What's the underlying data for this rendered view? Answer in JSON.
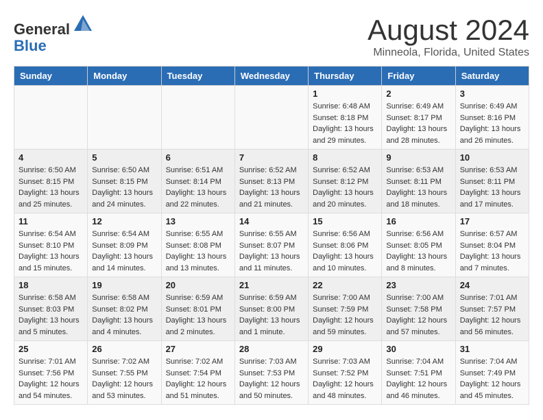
{
  "header": {
    "logo_line1": "General",
    "logo_line2": "Blue",
    "month": "August 2024",
    "location": "Minneola, Florida, United States"
  },
  "weekdays": [
    "Sunday",
    "Monday",
    "Tuesday",
    "Wednesday",
    "Thursday",
    "Friday",
    "Saturday"
  ],
  "weeks": [
    [
      {
        "day": "",
        "sunrise": "",
        "sunset": "",
        "daylight": ""
      },
      {
        "day": "",
        "sunrise": "",
        "sunset": "",
        "daylight": ""
      },
      {
        "day": "",
        "sunrise": "",
        "sunset": "",
        "daylight": ""
      },
      {
        "day": "",
        "sunrise": "",
        "sunset": "",
        "daylight": ""
      },
      {
        "day": "1",
        "sunrise": "Sunrise: 6:48 AM",
        "sunset": "Sunset: 8:18 PM",
        "daylight": "Daylight: 13 hours and 29 minutes."
      },
      {
        "day": "2",
        "sunrise": "Sunrise: 6:49 AM",
        "sunset": "Sunset: 8:17 PM",
        "daylight": "Daylight: 13 hours and 28 minutes."
      },
      {
        "day": "3",
        "sunrise": "Sunrise: 6:49 AM",
        "sunset": "Sunset: 8:16 PM",
        "daylight": "Daylight: 13 hours and 26 minutes."
      }
    ],
    [
      {
        "day": "4",
        "sunrise": "Sunrise: 6:50 AM",
        "sunset": "Sunset: 8:15 PM",
        "daylight": "Daylight: 13 hours and 25 minutes."
      },
      {
        "day": "5",
        "sunrise": "Sunrise: 6:50 AM",
        "sunset": "Sunset: 8:15 PM",
        "daylight": "Daylight: 13 hours and 24 minutes."
      },
      {
        "day": "6",
        "sunrise": "Sunrise: 6:51 AM",
        "sunset": "Sunset: 8:14 PM",
        "daylight": "Daylight: 13 hours and 22 minutes."
      },
      {
        "day": "7",
        "sunrise": "Sunrise: 6:52 AM",
        "sunset": "Sunset: 8:13 PM",
        "daylight": "Daylight: 13 hours and 21 minutes."
      },
      {
        "day": "8",
        "sunrise": "Sunrise: 6:52 AM",
        "sunset": "Sunset: 8:12 PM",
        "daylight": "Daylight: 13 hours and 20 minutes."
      },
      {
        "day": "9",
        "sunrise": "Sunrise: 6:53 AM",
        "sunset": "Sunset: 8:11 PM",
        "daylight": "Daylight: 13 hours and 18 minutes."
      },
      {
        "day": "10",
        "sunrise": "Sunrise: 6:53 AM",
        "sunset": "Sunset: 8:11 PM",
        "daylight": "Daylight: 13 hours and 17 minutes."
      }
    ],
    [
      {
        "day": "11",
        "sunrise": "Sunrise: 6:54 AM",
        "sunset": "Sunset: 8:10 PM",
        "daylight": "Daylight: 13 hours and 15 minutes."
      },
      {
        "day": "12",
        "sunrise": "Sunrise: 6:54 AM",
        "sunset": "Sunset: 8:09 PM",
        "daylight": "Daylight: 13 hours and 14 minutes."
      },
      {
        "day": "13",
        "sunrise": "Sunrise: 6:55 AM",
        "sunset": "Sunset: 8:08 PM",
        "daylight": "Daylight: 13 hours and 13 minutes."
      },
      {
        "day": "14",
        "sunrise": "Sunrise: 6:55 AM",
        "sunset": "Sunset: 8:07 PM",
        "daylight": "Daylight: 13 hours and 11 minutes."
      },
      {
        "day": "15",
        "sunrise": "Sunrise: 6:56 AM",
        "sunset": "Sunset: 8:06 PM",
        "daylight": "Daylight: 13 hours and 10 minutes."
      },
      {
        "day": "16",
        "sunrise": "Sunrise: 6:56 AM",
        "sunset": "Sunset: 8:05 PM",
        "daylight": "Daylight: 13 hours and 8 minutes."
      },
      {
        "day": "17",
        "sunrise": "Sunrise: 6:57 AM",
        "sunset": "Sunset: 8:04 PM",
        "daylight": "Daylight: 13 hours and 7 minutes."
      }
    ],
    [
      {
        "day": "18",
        "sunrise": "Sunrise: 6:58 AM",
        "sunset": "Sunset: 8:03 PM",
        "daylight": "Daylight: 13 hours and 5 minutes."
      },
      {
        "day": "19",
        "sunrise": "Sunrise: 6:58 AM",
        "sunset": "Sunset: 8:02 PM",
        "daylight": "Daylight: 13 hours and 4 minutes."
      },
      {
        "day": "20",
        "sunrise": "Sunrise: 6:59 AM",
        "sunset": "Sunset: 8:01 PM",
        "daylight": "Daylight: 13 hours and 2 minutes."
      },
      {
        "day": "21",
        "sunrise": "Sunrise: 6:59 AM",
        "sunset": "Sunset: 8:00 PM",
        "daylight": "Daylight: 13 hours and 1 minute."
      },
      {
        "day": "22",
        "sunrise": "Sunrise: 7:00 AM",
        "sunset": "Sunset: 7:59 PM",
        "daylight": "Daylight: 12 hours and 59 minutes."
      },
      {
        "day": "23",
        "sunrise": "Sunrise: 7:00 AM",
        "sunset": "Sunset: 7:58 PM",
        "daylight": "Daylight: 12 hours and 57 minutes."
      },
      {
        "day": "24",
        "sunrise": "Sunrise: 7:01 AM",
        "sunset": "Sunset: 7:57 PM",
        "daylight": "Daylight: 12 hours and 56 minutes."
      }
    ],
    [
      {
        "day": "25",
        "sunrise": "Sunrise: 7:01 AM",
        "sunset": "Sunset: 7:56 PM",
        "daylight": "Daylight: 12 hours and 54 minutes."
      },
      {
        "day": "26",
        "sunrise": "Sunrise: 7:02 AM",
        "sunset": "Sunset: 7:55 PM",
        "daylight": "Daylight: 12 hours and 53 minutes."
      },
      {
        "day": "27",
        "sunrise": "Sunrise: 7:02 AM",
        "sunset": "Sunset: 7:54 PM",
        "daylight": "Daylight: 12 hours and 51 minutes."
      },
      {
        "day": "28",
        "sunrise": "Sunrise: 7:03 AM",
        "sunset": "Sunset: 7:53 PM",
        "daylight": "Daylight: 12 hours and 50 minutes."
      },
      {
        "day": "29",
        "sunrise": "Sunrise: 7:03 AM",
        "sunset": "Sunset: 7:52 PM",
        "daylight": "Daylight: 12 hours and 48 minutes."
      },
      {
        "day": "30",
        "sunrise": "Sunrise: 7:04 AM",
        "sunset": "Sunset: 7:51 PM",
        "daylight": "Daylight: 12 hours and 46 minutes."
      },
      {
        "day": "31",
        "sunrise": "Sunrise: 7:04 AM",
        "sunset": "Sunset: 7:49 PM",
        "daylight": "Daylight: 12 hours and 45 minutes."
      }
    ]
  ]
}
